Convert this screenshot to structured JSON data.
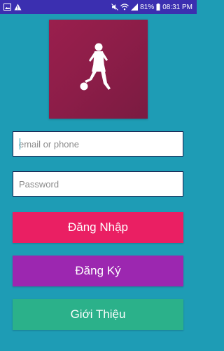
{
  "status_bar": {
    "battery": "81%",
    "time": "08:31 PM",
    "left_icons": [
      "image-icon",
      "warning-icon"
    ],
    "right_icons": [
      "mute-icon",
      "wifi-icon",
      "signal-icon",
      "battery-icon"
    ]
  },
  "logo": {
    "icon": "soccer-player-icon",
    "color": "#8c1d48"
  },
  "form": {
    "email_placeholder": "email or phone",
    "email_value": "",
    "password_placeholder": "Password",
    "password_value": ""
  },
  "buttons": {
    "login_label": "Đăng Nhập",
    "register_label": "Đăng Ký",
    "intro_label": "Giới Thiệu"
  },
  "colors": {
    "background": "#1e9cb5",
    "status_bar": "#3b2fb0",
    "login": "#ea1f63",
    "register": "#9c27b0",
    "intro": "#2bb18a"
  }
}
